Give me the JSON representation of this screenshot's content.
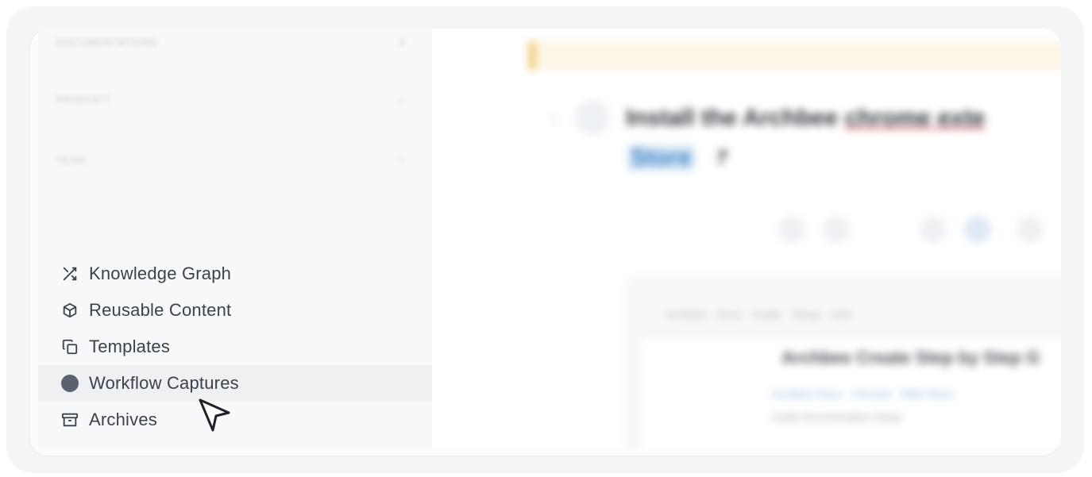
{
  "sidebar": {
    "sections": [
      {
        "label": "DOCUMENTATIONS",
        "chevron": "▾"
      },
      {
        "label": "PRODUCT",
        "chevron": "+"
      },
      {
        "label": "TEAM",
        "chevron": "+"
      }
    ],
    "nav": [
      {
        "label": "Knowledge Graph",
        "icon": "shuffle-icon"
      },
      {
        "label": "Reusable Content",
        "icon": "cube-icon"
      },
      {
        "label": "Templates",
        "icon": "copy-icon"
      },
      {
        "label": "Workflow Captures",
        "icon": "record-circle-icon",
        "active": true
      },
      {
        "label": "Archives",
        "icon": "archive-box-icon"
      }
    ]
  },
  "document": {
    "title_part1": "Install the Archbee ",
    "title_part2": "chrome exte",
    "link_text": "Store",
    "breadcrumb": "Archbee · Docs · Guide · Setup · Intro",
    "card_heading": "Archbee Create Step by Step G",
    "card_sub": "Archbee Docs · Chrome · Web Store",
    "card_tags": "Guide   Documentation   Setup"
  },
  "colors": {
    "text": "#3b424b",
    "active_bg": "#eef0f2",
    "banner_accent": "#f0c76b",
    "link": "#3b82c4"
  }
}
